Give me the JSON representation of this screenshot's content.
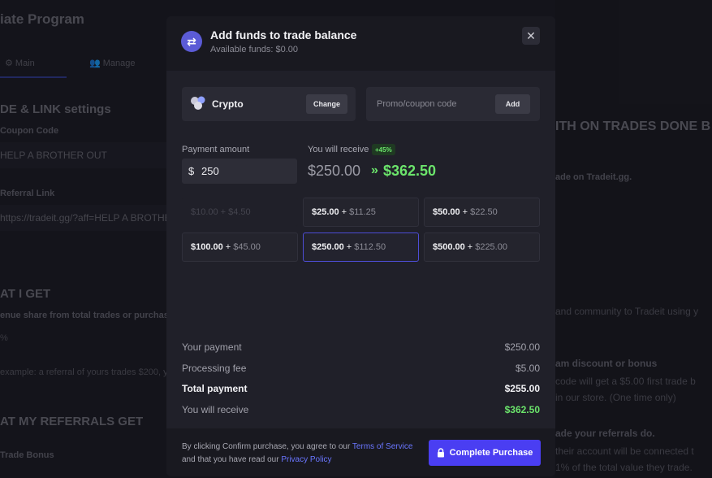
{
  "background": {
    "title": "iate Program",
    "tabs": [
      {
        "label": "Main"
      },
      {
        "label": "Manage"
      }
    ],
    "code_heading": "DE & LINK settings",
    "coupon_label": "Coupon Code",
    "coupon_value": "HELP A BROTHER OUT",
    "referral_label": "Referral Link",
    "referral_value": "https://tradeit.gg/?aff=HELP A BROTHE",
    "what_i_get": "AT I GET",
    "revenue_text": "enue share from total trades or purchases",
    "percent_text": "%",
    "example_text": "example: a referral of yours trades $200, y",
    "referrals_get": "AT MY REFERRALS GET",
    "trade_bonus": "Trade Bonus",
    "right_heading": "ITH ON TRADES DONE B",
    "right_line1": "ade on Tradeit.gg.",
    "right_line2": "and community to Tradeit using y",
    "right_line3": "am discount or bonus",
    "right_line4": "code will get a $5.00 first trade b",
    "right_line5": "in our store. (One time only)",
    "right_line6": "ade your referrals do.",
    "right_line7": "their account will be connected t",
    "right_line8": "1% of the total value they trade."
  },
  "modal": {
    "title": "Add funds to trade balance",
    "available": "Available funds: $0.00",
    "method": {
      "label": "Crypto",
      "change_label": "Change"
    },
    "promo": {
      "placeholder": "Promo/coupon code",
      "add_label": "Add"
    },
    "payment_amount_label": "Payment amount",
    "currency_symbol": "$",
    "payment_amount_value": "250",
    "you_will_receive_label": "You will receive",
    "bonus_badge": "+45%",
    "receive_old": "$250.00",
    "receive_arrow": "»",
    "receive_new": "$362.50",
    "presets": [
      {
        "amount": "$10.00",
        "plus": "+",
        "bonus": "$4.50",
        "state": "disabled"
      },
      {
        "amount": "$25.00",
        "plus": "+",
        "bonus": "$11.25",
        "state": "normal"
      },
      {
        "amount": "$50.00",
        "plus": "+",
        "bonus": "$22.50",
        "state": "normal"
      },
      {
        "amount": "$100.00",
        "plus": "+",
        "bonus": "$45.00",
        "state": "normal"
      },
      {
        "amount": "$250.00",
        "plus": "+",
        "bonus": "$112.50",
        "state": "selected"
      },
      {
        "amount": "$500.00",
        "plus": "+",
        "bonus": "$225.00",
        "state": "normal"
      }
    ],
    "summary": [
      {
        "label": "Your payment",
        "value": "$250.00"
      },
      {
        "label": "Processing fee",
        "value": "$5.00"
      },
      {
        "label": "Total payment",
        "value": "$255.00"
      },
      {
        "label": "You will receive",
        "value": "$362.50"
      }
    ],
    "terms": {
      "prefix": "By clicking Confirm purchase, you agree to our ",
      "terms_link": "Terms of Service",
      "middle": " and that you have read our ",
      "privacy_link": "Privacy Policy"
    },
    "purchase_label": "Complete Purchase"
  },
  "colors": {
    "accent": "#4a3ef2",
    "green": "#6be46b",
    "link": "#6a76ff"
  }
}
